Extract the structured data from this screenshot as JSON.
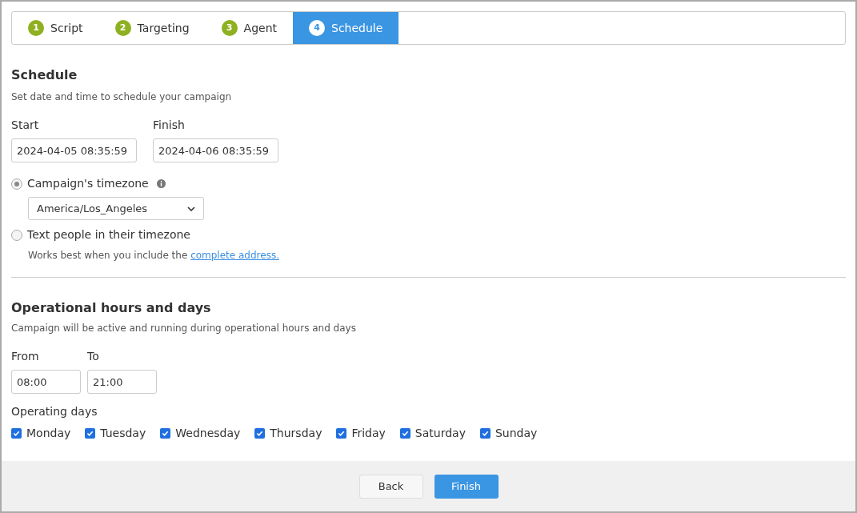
{
  "steps": [
    {
      "number": "1",
      "label": "Script",
      "selected": false
    },
    {
      "number": "2",
      "label": "Targeting",
      "selected": false
    },
    {
      "number": "3",
      "label": "Agent",
      "selected": false
    },
    {
      "number": "4",
      "label": "Schedule",
      "selected": true
    }
  ],
  "schedule": {
    "title": "Schedule",
    "subtitle": "Set date and time to schedule your campaign",
    "start": {
      "label": "Start",
      "value": "2024-04-05 08:35:59"
    },
    "finish": {
      "label": "Finish",
      "value": "2024-04-06 08:35:59"
    },
    "timezone_options": [
      {
        "label": "Campaign's timezone",
        "selected": true,
        "info": true,
        "select_value": "America/Los_Angeles"
      },
      {
        "label": "Text people in their timezone",
        "selected": false,
        "hint": "Works best when you include the",
        "link": "complete address."
      }
    ]
  },
  "operational": {
    "title": "Operational hours and days",
    "subtitle": "Campaign will be active and running during operational hours and days",
    "from": {
      "label": "From",
      "value": "08:00"
    },
    "to": {
      "label": "To",
      "value": "21:00"
    },
    "days_label": "Operating days",
    "days": [
      {
        "label": "Monday",
        "checked": true
      },
      {
        "label": "Tuesday",
        "checked": true
      },
      {
        "label": "Wednesday",
        "checked": true
      },
      {
        "label": "Thursday",
        "checked": true
      },
      {
        "label": "Friday",
        "checked": true
      },
      {
        "label": "Saturday",
        "checked": true
      },
      {
        "label": "Sunday",
        "checked": true
      }
    ]
  },
  "buttons": [
    {
      "label": "Back",
      "kind": "secondary"
    },
    {
      "label": "Finish",
      "kind": "primary"
    }
  ]
}
